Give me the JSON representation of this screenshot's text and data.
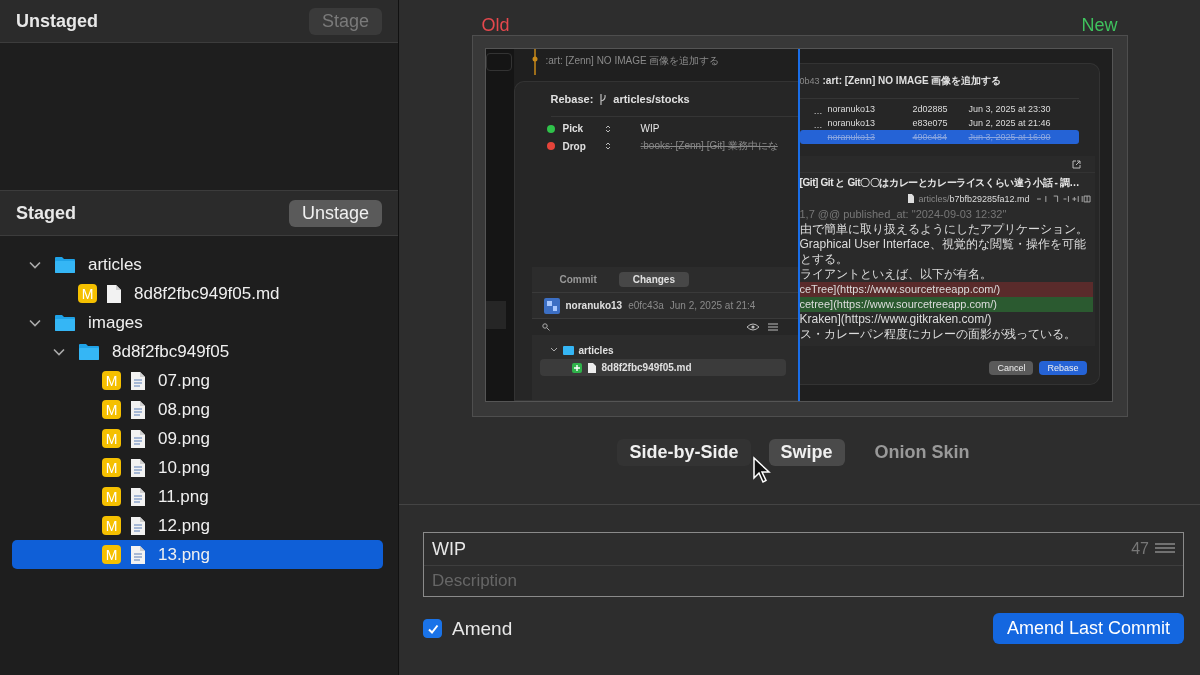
{
  "unstaged": {
    "title": "Unstaged",
    "button": "Stage",
    "button_disabled": true
  },
  "staged": {
    "title": "Staged",
    "button": "Unstage",
    "button_disabled": false,
    "tree": [
      {
        "name": "articles",
        "kind": "folder",
        "expanded": true,
        "selected": false,
        "children": [
          {
            "name": "8d8f2fbc949f05.md",
            "kind": "document",
            "badge": "M",
            "selected": false
          }
        ]
      },
      {
        "name": "images",
        "kind": "folder",
        "expanded": true,
        "selected": false,
        "children": [
          {
            "name": "8d8f2fbc949f05",
            "kind": "folder",
            "expanded": true,
            "selected": false,
            "children": [
              {
                "name": "07.png",
                "kind": "image",
                "badge": "M",
                "selected": false
              },
              {
                "name": "08.png",
                "kind": "image",
                "badge": "M",
                "selected": false
              },
              {
                "name": "09.png",
                "kind": "image",
                "badge": "M",
                "selected": false
              },
              {
                "name": "10.png",
                "kind": "image",
                "badge": "M",
                "selected": false
              },
              {
                "name": "11.png",
                "kind": "image",
                "badge": "M",
                "selected": false
              },
              {
                "name": "12.png",
                "kind": "image",
                "badge": "M",
                "selected": false
              },
              {
                "name": "13.png",
                "kind": "image",
                "badge": "M",
                "selected": true
              }
            ]
          }
        ]
      }
    ]
  },
  "preview": {
    "old_label": "Old",
    "new_label": "New",
    "old_image": {
      "log_title": ":art: [Zenn] NO IMAGE 画像を追加する",
      "rebase_label": "Rebase:",
      "branch": "articles/stocks",
      "steps": [
        {
          "action": "Pick",
          "color": "#2fc24a",
          "message": "WIP",
          "dropped": false
        },
        {
          "action": "Drop",
          "color": "#e5443a",
          "message": ":books: [Zenn] [Git] 業務中にな",
          "dropped": true
        }
      ],
      "tabs": [
        {
          "label": "Commit",
          "selected": false
        },
        {
          "label": "Changes",
          "selected": true
        }
      ],
      "author": "noranuko13",
      "hash": "e0fc43a",
      "date": "Jun 2, 2025 at 21:4",
      "tree_folder": "articles",
      "tree_file": "8d8f2fbc949f05.md"
    },
    "new_image": {
      "hash_fragment": "0b43",
      "title": ":art: [Zenn] NO IMAGE 画像を追加する",
      "commits": [
        {
          "marker": "…",
          "author": "noranuko13",
          "hash": "2d02885",
          "date": "Jun 3, 2025 at 23:30",
          "selected": false,
          "dropped": false
        },
        {
          "marker": "…",
          "author": "noranuko13",
          "hash": "e83e075",
          "date": "Jun 2, 2025 at 21:46",
          "selected": false,
          "dropped": false
        },
        {
          "author": "noranuko13",
          "hash": "490c484",
          "date": "Jun 3, 2025 at 16:00",
          "selected": true,
          "dropped": true
        }
      ],
      "article_title": "[Git] Git と Git〇〇はカレーとカレーライスくらい違う小話 - 調…",
      "file_folder": "articles/",
      "file_name": "b7bfb29285fa12.md",
      "diff": [
        {
          "kind": "hunk",
          "text": "1,7 @@ published_at: \"2024-09-03 12:32\""
        },
        {
          "kind": "context",
          "text": "由で簡単に取り扱えるようにしたアプリケーション。"
        },
        {
          "kind": "context",
          "text": "Graphical User Interface、視覚的な閲覧・操作を可能とする。"
        },
        {
          "kind": "context",
          "text": "ライアントといえば、以下が有名。"
        },
        {
          "kind": "removed",
          "text": "ceTree](https://www.sourcetreeapp.com/)"
        },
        {
          "kind": "added",
          "text": "cetree](https://www.sourcetreeapp.com/)"
        },
        {
          "kind": "context",
          "text": "Kraken](https://www.gitkraken.com/)"
        },
        {
          "kind": "context",
          "text": "ス・カレーパン程度にカレーの面影が残っている。"
        }
      ],
      "buttons": [
        {
          "label": "Cancel",
          "primary": false
        },
        {
          "label": "Rebase",
          "primary": true
        }
      ]
    }
  },
  "view_modes": [
    {
      "label": "Side-by-Side",
      "selected": false,
      "hovered": true
    },
    {
      "label": "Swipe",
      "selected": true,
      "hovered": false
    },
    {
      "label": "Onion Skin",
      "selected": false,
      "hovered": false
    }
  ],
  "commit": {
    "message": "WIP",
    "char_count": "47",
    "description_placeholder": "Description",
    "amend_label": "Amend",
    "amend_checked": true,
    "button": "Amend Last Commit"
  }
}
